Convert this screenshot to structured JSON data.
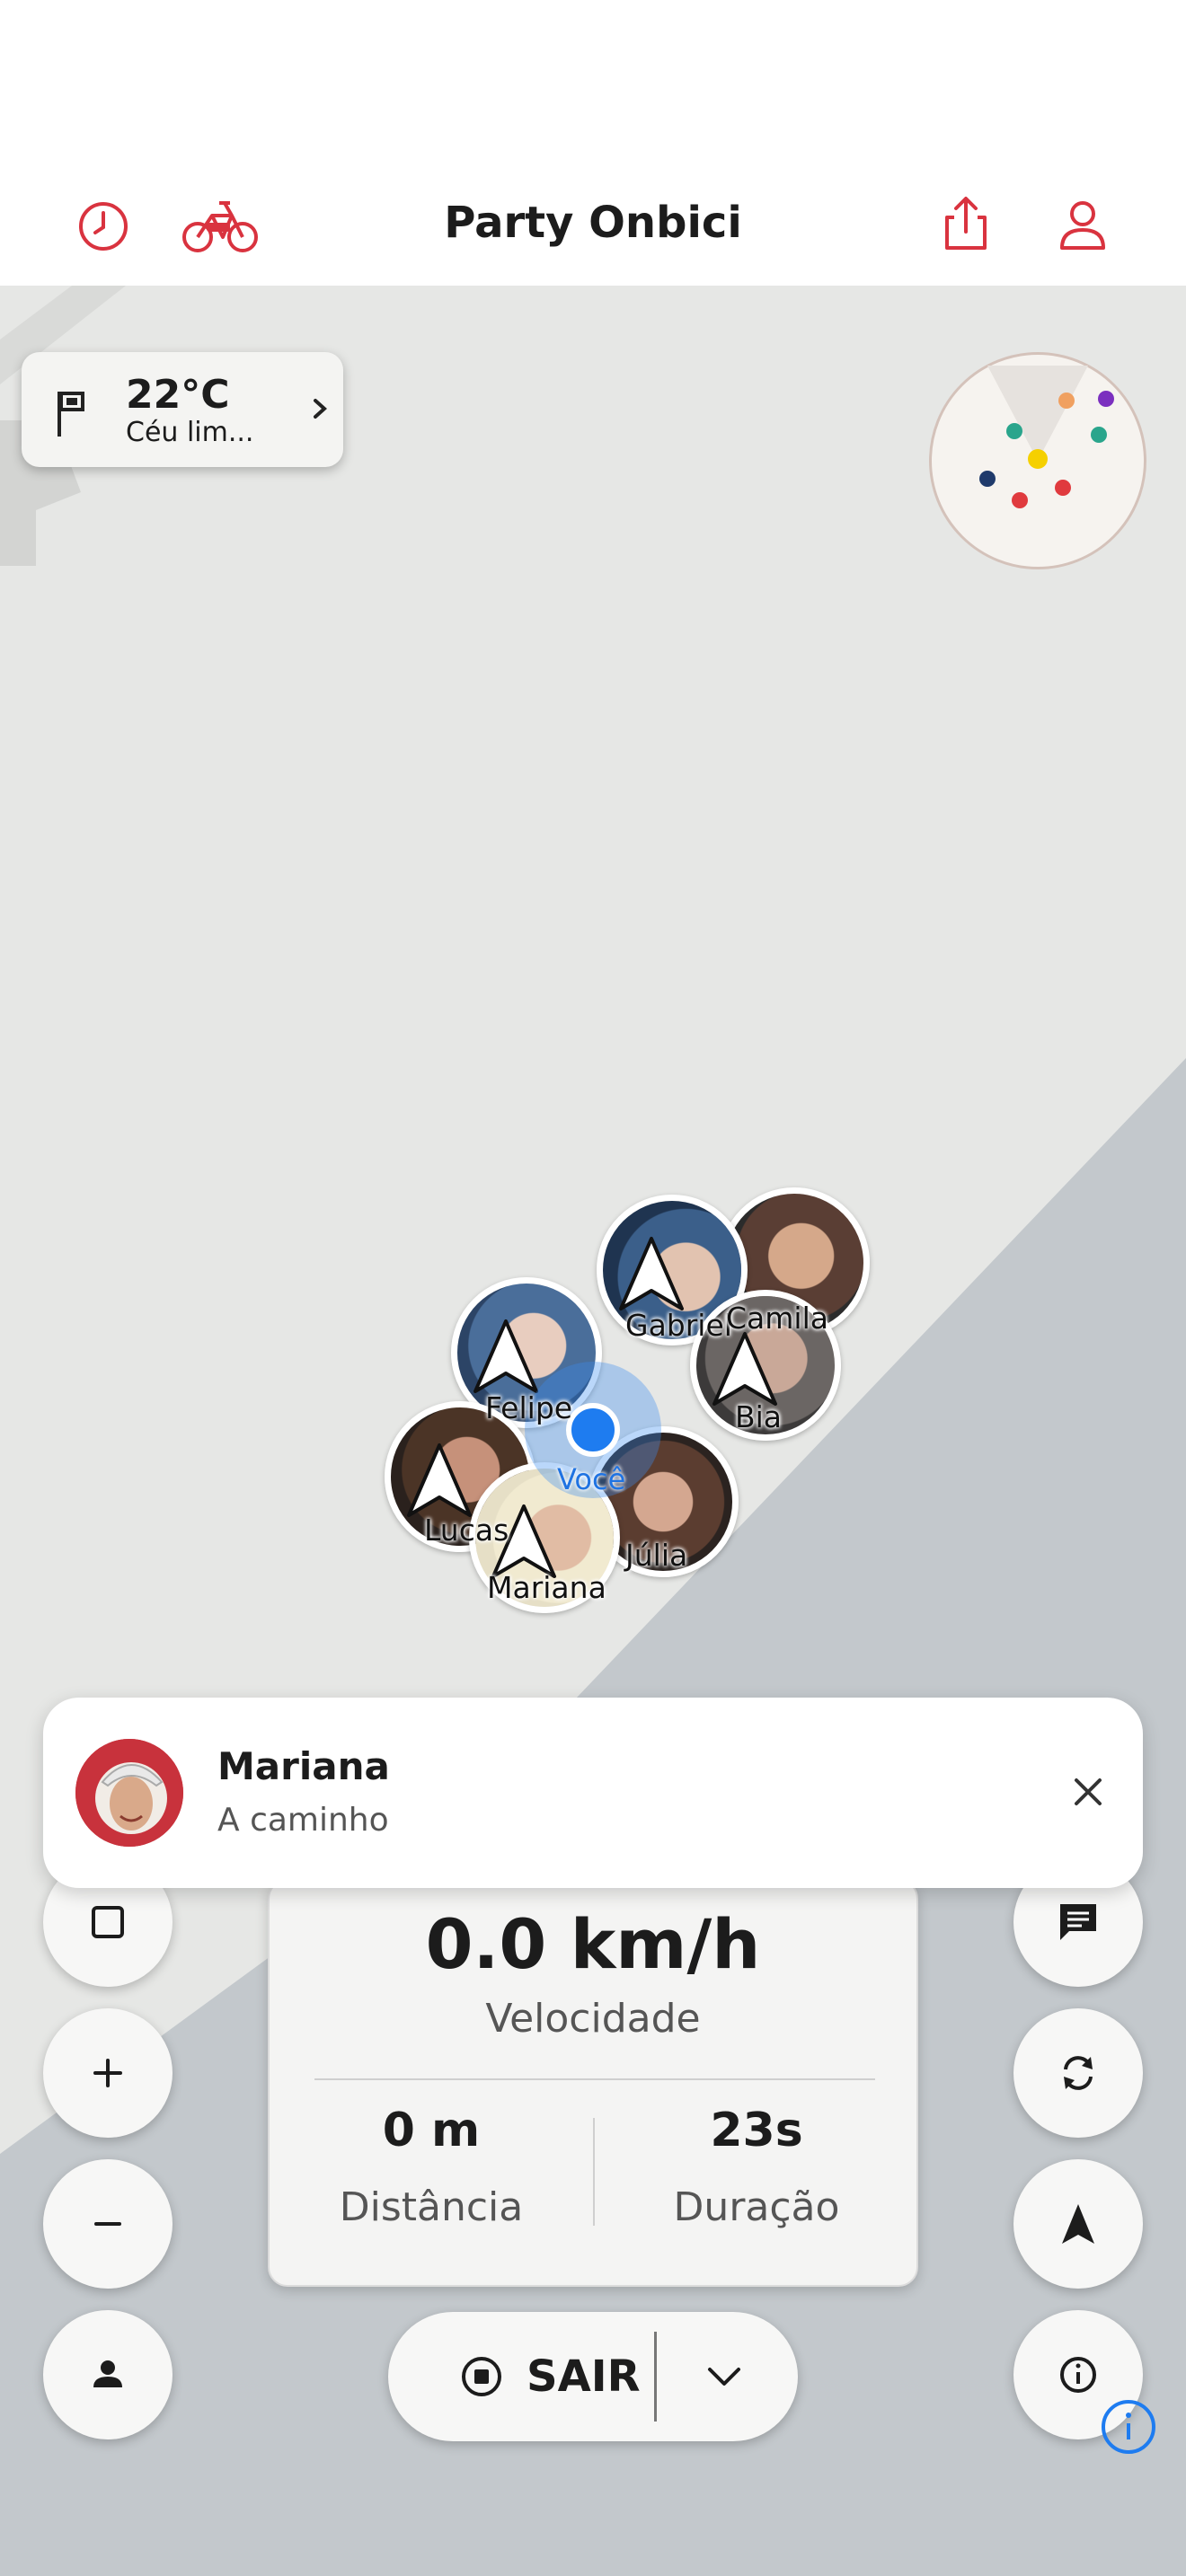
{
  "app": {
    "title": "Party Onbici",
    "accent_color": "#d9333f",
    "icons": [
      "history-icon",
      "bicycle-icon",
      "share-icon",
      "profile-icon"
    ]
  },
  "weather": {
    "temperature": "22°C",
    "condition": "Céu lim...",
    "icons": [
      "flag-icon",
      "chevron-right-icon"
    ]
  },
  "radar": {
    "dot_colors": [
      "#f0a060",
      "#7b2fbf",
      "#2aa58c",
      "#2aa58c",
      "#f5d000",
      "#e03a3e",
      "#e03a3e",
      "#1f3a6b"
    ]
  },
  "map": {
    "riders": [
      {
        "name": "Gabriel"
      },
      {
        "name": "Camila"
      },
      {
        "name": "Felipe"
      },
      {
        "name": "Bia"
      },
      {
        "name": "Lucas"
      },
      {
        "name": "Júlia"
      },
      {
        "name": "Mariana"
      }
    ],
    "self_label": "Você"
  },
  "notification": {
    "name": "Mariana",
    "status": "A caminho"
  },
  "stats": {
    "speed": "0.0 km/h",
    "speed_label": "Velocidade",
    "distance": "0 m",
    "distance_label": "Distância",
    "duration": "23s",
    "duration_label": "Duração"
  },
  "controls": {
    "left": [
      "stop-square-icon",
      "zoom-in-icon",
      "zoom-out-icon",
      "person-icon"
    ],
    "right": [
      "chat-icon",
      "refresh-icon",
      "navigation-arrow-icon",
      "info-icon"
    ],
    "exit_label": "SAIR"
  }
}
